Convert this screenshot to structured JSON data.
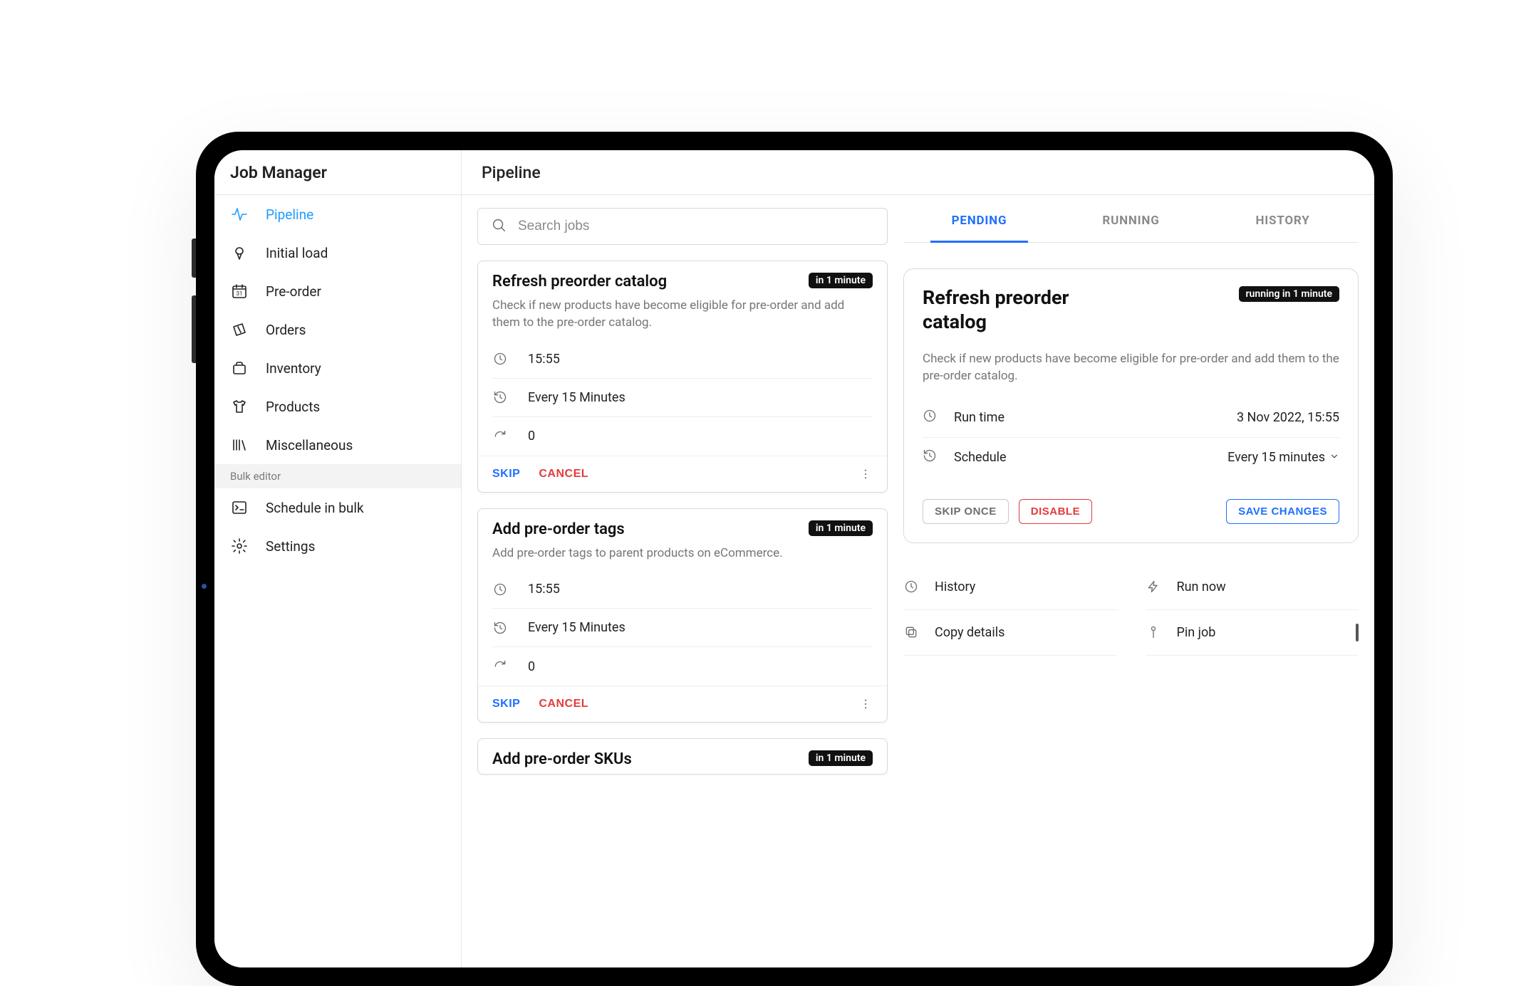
{
  "sidebar": {
    "title": "Job Manager",
    "items": [
      {
        "label": "Pipeline",
        "icon": "pulse"
      },
      {
        "label": "Initial load",
        "icon": "icecream"
      },
      {
        "label": "Pre-order",
        "icon": "calendar"
      },
      {
        "label": "Orders",
        "icon": "ticket"
      },
      {
        "label": "Inventory",
        "icon": "box"
      },
      {
        "label": "Products",
        "icon": "shirt"
      },
      {
        "label": "Miscellaneous",
        "icon": "library"
      }
    ],
    "section_label": "Bulk editor",
    "bulk_items": [
      {
        "label": "Schedule in bulk",
        "icon": "terminal"
      },
      {
        "label": "Settings",
        "icon": "gear"
      }
    ]
  },
  "header": {
    "title": "Pipeline"
  },
  "search": {
    "placeholder": "Search jobs"
  },
  "tabs": {
    "pending": "PENDING",
    "running": "RUNNING",
    "history": "HISTORY"
  },
  "jobs": [
    {
      "title": "Refresh preorder catalog",
      "badge": "in 1 minute",
      "desc": "Check if new products have become eligible for pre-order and add them to the pre-order catalog.",
      "time": "15:55",
      "freq": "Every 15 Minutes",
      "count": "0",
      "skip": "SKIP",
      "cancel": "CANCEL"
    },
    {
      "title": "Add pre-order tags",
      "badge": "in 1 minute",
      "desc": "Add pre-order tags to parent products on eCommerce.",
      "time": "15:55",
      "freq": "Every 15 Minutes",
      "count": "0",
      "skip": "SKIP",
      "cancel": "CANCEL"
    },
    {
      "title": "Add pre-order SKUs",
      "badge": "in 1 minute"
    }
  ],
  "detail": {
    "title": "Refresh preorder catalog",
    "badge": "running in 1 minute",
    "desc": "Check if new products have become eligible for pre-order and add them to the pre-order catalog.",
    "runtime_label": "Run time",
    "runtime_value": "3 Nov 2022, 15:55",
    "schedule_label": "Schedule",
    "schedule_value": "Every 15 minutes",
    "skip_once": "SKIP ONCE",
    "disable": "DISABLE",
    "save": "SAVE CHANGES"
  },
  "quick": {
    "history": "History",
    "runnow": "Run now",
    "copy": "Copy details",
    "pin": "Pin job"
  }
}
